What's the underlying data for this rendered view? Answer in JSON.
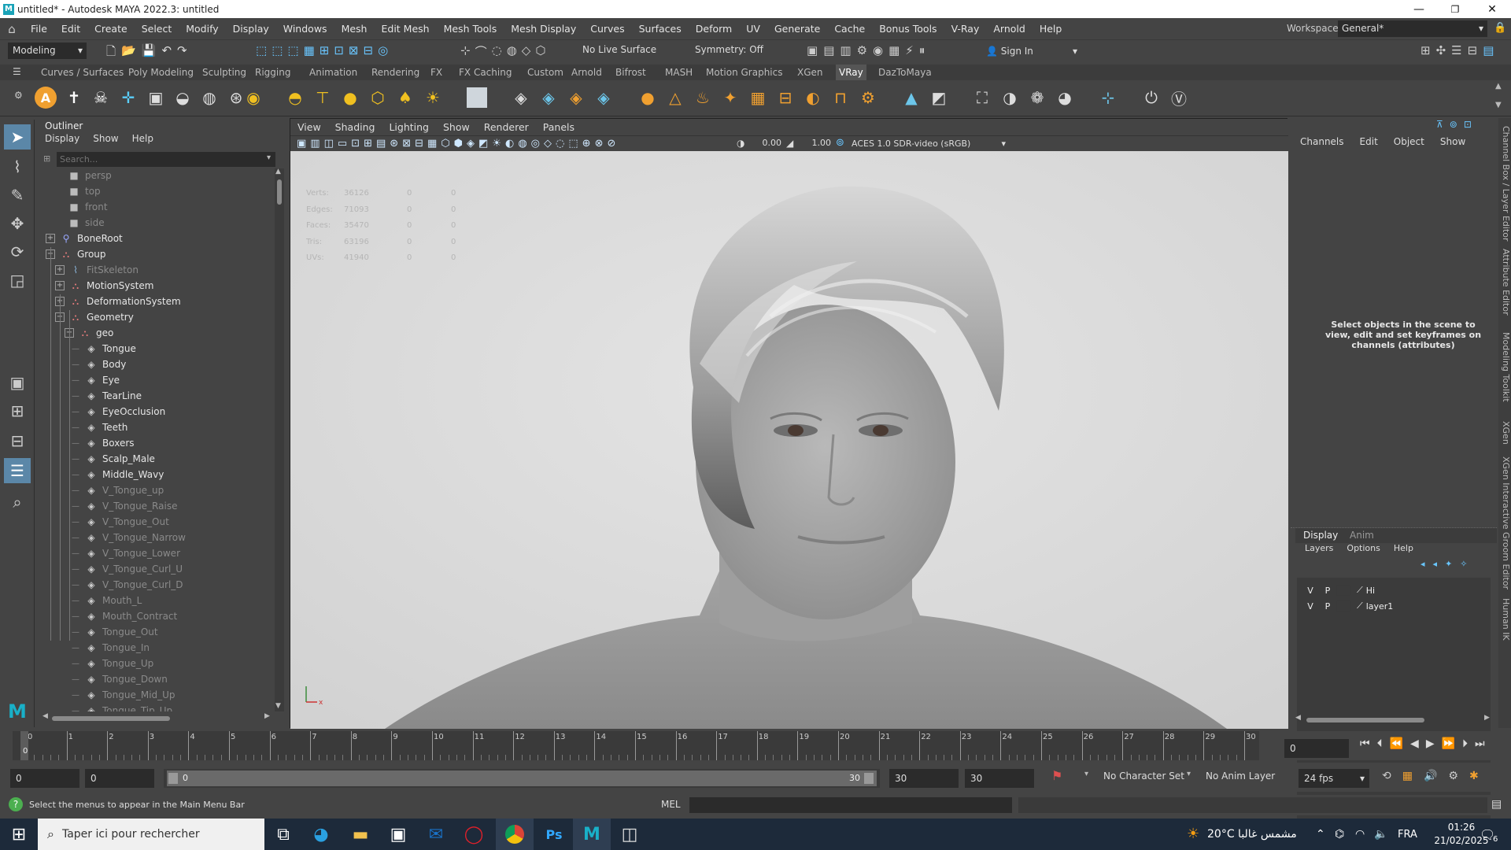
{
  "window": {
    "title": "untitled* - Autodesk MAYA 2022.3: untitled"
  },
  "menubar": {
    "items": [
      "File",
      "Edit",
      "Create",
      "Select",
      "Modify",
      "Display",
      "Windows",
      "Mesh",
      "Edit Mesh",
      "Mesh Tools",
      "Mesh Display",
      "Curves",
      "Surfaces",
      "Deform",
      "UV",
      "Generate",
      "Cache",
      "Bonus Tools",
      "V-Ray",
      "Arnold",
      "Help"
    ],
    "workspace_label": "Workspace:",
    "workspace_value": "General*"
  },
  "statusline": {
    "mode": "Modeling",
    "live_surface": "No Live Surface",
    "symmetry": "Symmetry: Off",
    "sign_in": "Sign In"
  },
  "shelf": {
    "tabs": [
      "Curves / Surfaces",
      "Poly Modeling",
      "Sculpting",
      "Rigging",
      "Animation",
      "Rendering",
      "FX",
      "FX Caching",
      "Custom",
      "Arnold",
      "Bifrost",
      "MASH",
      "Motion Graphics",
      "XGen",
      "VRay",
      "DazToMaya"
    ],
    "active_tab": "VRay"
  },
  "outliner": {
    "title": "Outliner",
    "menu": [
      "Display",
      "Show",
      "Help"
    ],
    "search_placeholder": "Search...",
    "items": [
      {
        "label": "persp",
        "dim": true
      },
      {
        "label": "top",
        "dim": true
      },
      {
        "label": "front",
        "dim": true
      },
      {
        "label": "side",
        "dim": true
      },
      {
        "label": "BoneRoot",
        "dim": false
      },
      {
        "label": "Group",
        "dim": false
      },
      {
        "label": "FitSkeleton",
        "dim": true
      },
      {
        "label": "MotionSystem",
        "dim": false
      },
      {
        "label": "DeformationSystem",
        "dim": false
      },
      {
        "label": "Geometry",
        "dim": false
      },
      {
        "label": "geo",
        "dim": false
      },
      {
        "label": "Tongue",
        "dim": false
      },
      {
        "label": "Body",
        "dim": false
      },
      {
        "label": "Eye",
        "dim": false
      },
      {
        "label": "TearLine",
        "dim": false
      },
      {
        "label": "EyeOcclusion",
        "dim": false
      },
      {
        "label": "Teeth",
        "dim": false
      },
      {
        "label": "Boxers",
        "dim": false
      },
      {
        "label": "Scalp_Male",
        "dim": false
      },
      {
        "label": "Middle_Wavy",
        "dim": false
      },
      {
        "label": "V_Tongue_up",
        "dim": true
      },
      {
        "label": "V_Tongue_Raise",
        "dim": true
      },
      {
        "label": "V_Tongue_Out",
        "dim": true
      },
      {
        "label": "V_Tongue_Narrow",
        "dim": true
      },
      {
        "label": "V_Tongue_Lower",
        "dim": true
      },
      {
        "label": "V_Tongue_Curl_U",
        "dim": true
      },
      {
        "label": "V_Tongue_Curl_D",
        "dim": true
      },
      {
        "label": "Mouth_L",
        "dim": true
      },
      {
        "label": "Mouth_Contract",
        "dim": true
      },
      {
        "label": "Tongue_Out",
        "dim": true
      },
      {
        "label": "Tongue_In",
        "dim": true
      },
      {
        "label": "Tongue_Up",
        "dim": true
      },
      {
        "label": "Tongue_Down",
        "dim": true
      },
      {
        "label": "Tongue_Mid_Up",
        "dim": true
      },
      {
        "label": "Tongue_Tip_Up",
        "dim": true
      }
    ]
  },
  "viewport": {
    "menu": [
      "View",
      "Shading",
      "Lighting",
      "Show",
      "Renderer",
      "Panels"
    ],
    "exposure": "0.00",
    "gamma": "1.00",
    "color_space": "ACES 1.0 SDR-video (sRGB)",
    "hud": [
      {
        "label": "Verts:",
        "value": "36126",
        "sel": "0",
        "extra": "0"
      },
      {
        "label": "Edges:",
        "value": "71093",
        "sel": "0",
        "extra": "0"
      },
      {
        "label": "Faces:",
        "value": "35470",
        "sel": "0",
        "extra": "0"
      },
      {
        "label": "Tris:",
        "value": "63196",
        "sel": "0",
        "extra": "0"
      },
      {
        "label": "UVs:",
        "value": "41940",
        "sel": "0",
        "extra": "0"
      }
    ]
  },
  "channelbox": {
    "menu": [
      "Channels",
      "Edit",
      "Object",
      "Show"
    ],
    "hint": "Select objects in the scene to view, edit and set keyframes on channels (attributes)",
    "layer_tabs": [
      "Display",
      "Anim"
    ],
    "layer_menu": [
      "Layers",
      "Options",
      "Help"
    ],
    "layers": [
      {
        "v": "V",
        "p": "P",
        "name": "Hi"
      },
      {
        "v": "V",
        "p": "P",
        "name": "layer1"
      }
    ]
  },
  "side_tabs": [
    "Channel Box / Layer Editor",
    "Attribute Editor",
    "Modeling Toolkit",
    "XGen",
    "XGen Interactive Groom Editor",
    "Human IK"
  ],
  "timeline": {
    "ticks": [
      "0",
      "1",
      "2",
      "3",
      "4",
      "5",
      "6",
      "7",
      "8",
      "9",
      "10",
      "11",
      "12",
      "13",
      "14",
      "15",
      "16",
      "17",
      "18",
      "19",
      "20",
      "21",
      "22",
      "23",
      "24",
      "25",
      "26",
      "27",
      "28",
      "29",
      "30"
    ],
    "current_frame": "0",
    "current_marker": "0"
  },
  "range": {
    "start": "0",
    "playback_start": "0",
    "slider_start": "0",
    "slider_end": "30",
    "playback_end": "30",
    "end": "30",
    "character_set": "No Character Set",
    "anim_layer": "No Anim Layer",
    "fps": "24 fps"
  },
  "cmd": {
    "status": "Select the menus to appear in the Main Menu Bar",
    "mel_label": "MEL"
  },
  "taskbar": {
    "search_placeholder": "Taper ici pour rechercher",
    "weather": "20°C  مشمس غالبا",
    "language": "FRA",
    "time": "01:26",
    "date": "21/02/2025",
    "notifications": "6"
  }
}
